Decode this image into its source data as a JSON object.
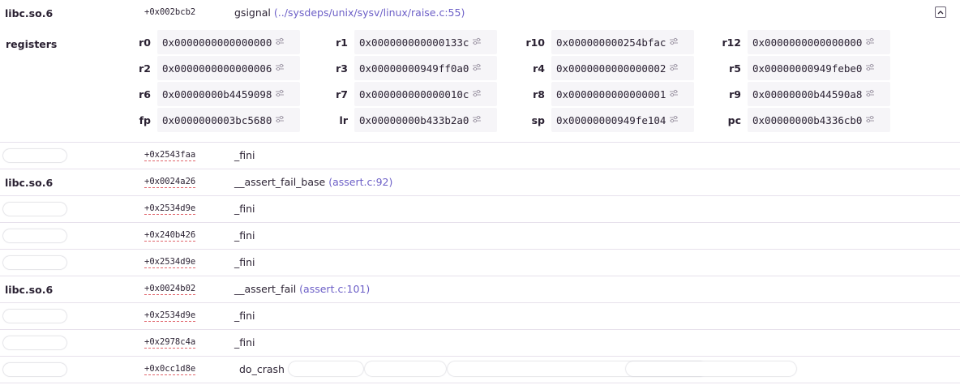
{
  "frames_top": {
    "module": "libc.so.6",
    "address": "+0x002bcb2",
    "function": "gsignal",
    "location": "(../sysdeps/unix/sysv/linux/raise.c:55)",
    "toggle_icon": "chevron-up-icon"
  },
  "registers": {
    "label": "registers",
    "items": [
      {
        "name": "r0",
        "value": "0x0000000000000000"
      },
      {
        "name": "r1",
        "value": "0x000000000000133c"
      },
      {
        "name": "r10",
        "value": "0x000000000254bfac"
      },
      {
        "name": "r12",
        "value": "0x0000000000000000"
      },
      {
        "name": "r2",
        "value": "0x0000000000000006"
      },
      {
        "name": "r3",
        "value": "0x00000000949ff0a0"
      },
      {
        "name": "r4",
        "value": "0x0000000000000002"
      },
      {
        "name": "r5",
        "value": "0x00000000949febe0"
      },
      {
        "name": "r6",
        "value": "0x00000000b4459098"
      },
      {
        "name": "r7",
        "value": "0x000000000000010c"
      },
      {
        "name": "r8",
        "value": "0x0000000000000001"
      },
      {
        "name": "r9",
        "value": "0x00000000b44590a8"
      },
      {
        "name": "fp",
        "value": "0x0000000003bc5680"
      },
      {
        "name": "lr",
        "value": "0x00000000b433b2a0"
      },
      {
        "name": "sp",
        "value": "0x00000000949fe104"
      },
      {
        "name": "pc",
        "value": "0x00000000b4336cb0"
      }
    ],
    "value_icon": "sliders-icon"
  },
  "frames": [
    {
      "module": "",
      "address": "+0x2543faa",
      "function": "_fini",
      "location": ""
    },
    {
      "module": "libc.so.6",
      "address": "+0x0024a26",
      "function": "__assert_fail_base",
      "location": "(assert.c:92)"
    },
    {
      "module": "",
      "address": "+0x2534d9e",
      "function": "_fini",
      "location": ""
    },
    {
      "module": "",
      "address": "+0x240b426",
      "function": "_fini",
      "location": ""
    },
    {
      "module": "",
      "address": "+0x2534d9e",
      "function": "_fini",
      "location": ""
    },
    {
      "module": "libc.so.6",
      "address": "+0x0024b02",
      "function": "__assert_fail",
      "location": "(assert.c:101)"
    },
    {
      "module": "",
      "address": "+0x2534d9e",
      "function": "_fini",
      "location": ""
    },
    {
      "module": "",
      "address": "+0x2978c4a",
      "function": "_fini",
      "location": ""
    },
    {
      "module": "",
      "address": "+0x0cc1d8e",
      "function": "do_crash",
      "location": ""
    }
  ],
  "colors": {
    "text": "#2b2233",
    "location": "#6c5fc7",
    "register_bg": "#f6f5f8",
    "divider": "#e7e1ec",
    "address_underline": "#e0646b"
  }
}
